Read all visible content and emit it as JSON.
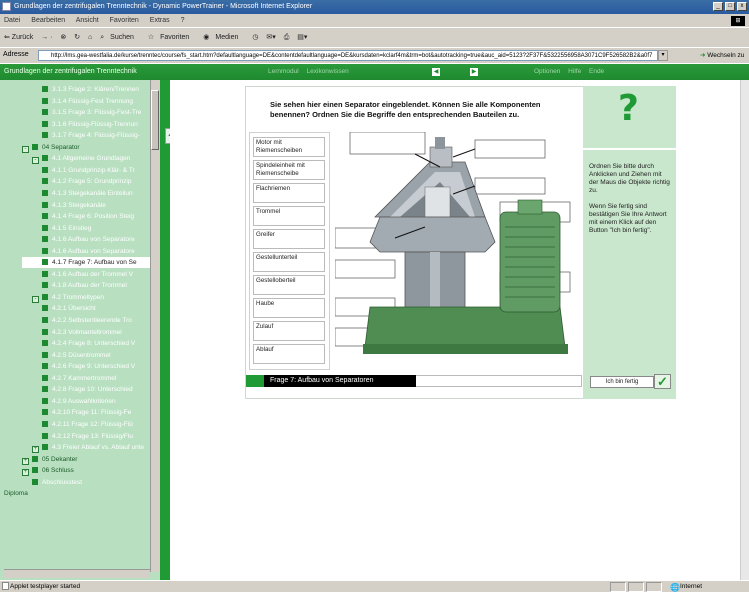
{
  "window": {
    "title": "Grundlagen der zentrifugalen Trenntechnik - Dynamic PowerTrainer - Microsoft Internet Explorer",
    "minimize": "_",
    "maximize": "□",
    "close": "x"
  },
  "menu": [
    "Datei",
    "Bearbeiten",
    "Ansicht",
    "Favoriten",
    "Extras",
    "?"
  ],
  "toolbar": {
    "back": "⇐ Zurück",
    "search": "Suchen",
    "favorites": "Favoriten",
    "media": "Medien"
  },
  "address": {
    "label": "Adresse",
    "url": "http://lms.gea-westfalia.de/kurse/trenntec/course/fs_start.htm?defaultlanguage=DE&contentdefaultlanguage=DE&kursdaten=kclarf4m&trm=bot&autotracking=true&auc_aid=5123?2F37F&5322556958A3071C9F526582B2&a0f7",
    "go_label": "Wechseln zu"
  },
  "nav": {
    "course_title": "Grundlagen der zentrifugalen Trenntechnik",
    "links_left": "Lernmodul   Lexikonwissen",
    "prev": "◀",
    "next": "▶",
    "links_right": "Optionen   Hilfe   Ende"
  },
  "sidebar": {
    "items": [
      {
        "label": "3.1.3 Frage 2: Klären/Trennen",
        "indent": 3
      },
      {
        "label": "3.1.4 Flüssig-Fest Trennung",
        "indent": 3
      },
      {
        "label": "3.1.5 Frage 3: Flüssig-Fest-Tre",
        "indent": 3
      },
      {
        "label": "3.1.6 Flüssig-Flüssig-Trennun",
        "indent": 3
      },
      {
        "label": "3.1.7 Frage 4: Flüssig-Flüssig-",
        "indent": 3
      },
      {
        "label": "04 Separator",
        "indent": 0,
        "toggle": "-"
      },
      {
        "label": "4.1 Allgemeine Grundlagen",
        "indent": 1,
        "toggle": "-"
      },
      {
        "label": "4.1.1 Grundprinzip Klär- & Tr",
        "indent": 3
      },
      {
        "label": "4.1.2 Frage 5: Grundprinzip",
        "indent": 3
      },
      {
        "label": "4.1.3 Steigekanäle Einteilun",
        "indent": 3
      },
      {
        "label": "4.1.3 Steigekanäle",
        "indent": 3
      },
      {
        "label": "4.1.4 Frage 6: Position Steig",
        "indent": 3
      },
      {
        "label": "4.1.5 Einstieg",
        "indent": 3
      },
      {
        "label": "4.1.6 Aufbau von Separatore",
        "indent": 3
      },
      {
        "label": "4.1.6 Aufbau von Separatore",
        "indent": 3
      },
      {
        "label": "4.1.7 Frage 7: Aufbau von Se",
        "indent": 3,
        "active": true
      },
      {
        "label": "4.1.6 Aufbau der Trommel V",
        "indent": 3
      },
      {
        "label": "4.1.8 Aufbau der Trommel",
        "indent": 3
      },
      {
        "label": "4.2 Trommeltypen",
        "indent": 1,
        "toggle": "-"
      },
      {
        "label": "4.2.1 Übersicht",
        "indent": 3
      },
      {
        "label": "4.2.2 Selbstentleerende Tro",
        "indent": 3
      },
      {
        "label": "4.2.3 Vollmanteltrommel",
        "indent": 3
      },
      {
        "label": "4.2.4 Frage 8: Unterschied V",
        "indent": 3
      },
      {
        "label": "4.2.5 Düsentrommel",
        "indent": 3
      },
      {
        "label": "4.2.6 Frage 9: Unterschied V",
        "indent": 3
      },
      {
        "label": "4.2.7 Kammertrommel",
        "indent": 3
      },
      {
        "label": "4.2.8 Frage 10: Unterschied",
        "indent": 3
      },
      {
        "label": "4.2.9 Auswahlkriterien",
        "indent": 3
      },
      {
        "label": "4.2.10 Frage 11: Flüssig-Fe",
        "indent": 3
      },
      {
        "label": "4.2.11 Frage 12: Flüssig-Flü",
        "indent": 3
      },
      {
        "label": "4.2.12 Frage 13: Flüssig/Flu",
        "indent": 3
      },
      {
        "label": "4.3 Freier Ablauf vs. Ablauf unte",
        "indent": 1,
        "toggle": "+"
      },
      {
        "label": "05 Dekanter",
        "indent": 0,
        "toggle": "+"
      },
      {
        "label": "06 Schluss",
        "indent": 0,
        "toggle": "+"
      },
      {
        "label": "Abschlusstest",
        "indent": 1
      },
      {
        "label": "Diploma",
        "indent": -1
      }
    ]
  },
  "question": {
    "text": "Sie sehen hier einen Separator eingeblendet. Können Sie alle Komponenten benennen? Ordnen Sie die Begriffe den entsprechenden Bauteilen zu."
  },
  "labels": [
    "Motor mit Riemenscheiben",
    "Spindeleinheit mit Riemenscheibe",
    "Flachriemen",
    "Trommel",
    "Greifer",
    "Gestellunterteil",
    "Gestelloberteil",
    "Haube",
    "Zulauf",
    "Ablauf"
  ],
  "help": {
    "icon": "?",
    "paragraph1": "Ordnen Sie bitte durch Anklicken und Ziehen mit der Maus die Objekte richtig zu.",
    "paragraph2": "Wenn Sie fertig sind bestätigen Sie Ihre Antwort mit einem Klick auf den Button \"Ich bin fertig\"."
  },
  "footer": {
    "title": "Frage 7: Aufbau von Separatoren",
    "done_button": "Ich bin fertig",
    "check": "✓"
  },
  "status": {
    "text": "Applet testplayer started",
    "zone": "Internet"
  },
  "colors": {
    "brand_green": "#1f9a35",
    "sidebar_bg": "#b7dfc0",
    "help_bg": "#c9e7cd"
  }
}
